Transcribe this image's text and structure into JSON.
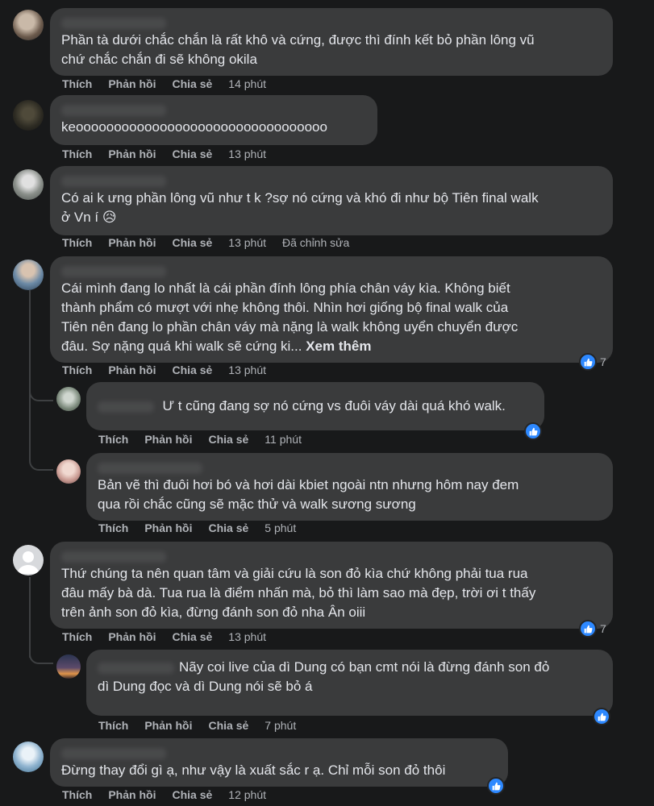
{
  "actions": {
    "like": "Thích",
    "reply": "Phản hồi",
    "share": "Chia sẻ"
  },
  "colors": {
    "background": "#18191a",
    "bubble": "#3a3b3c",
    "like_blue": "#2d88ff",
    "meta_text": "#b0b3b8"
  },
  "comments": [
    {
      "text": "Phần tà dưới chắc chắn là rất khô và cứng, được thì đính kết bỏ phần lông vũ\nchứ chắc chắn đi sẽ không okila",
      "time": "14 phút"
    },
    {
      "text": "keooooooooooooooooooooooooooooooooo",
      "time": "13 phút"
    },
    {
      "text": "Có ai k ưng phần lông vũ như t k ?sợ nó cứng và khó đi như bộ Tiên final walk\nở Vn í 😥",
      "time": "13 phút",
      "edited": "Đã chỉnh sửa"
    },
    {
      "text": "Cái mình đang lo nhất là cái phần đính lông phía chân váy kìa. Không biết\nthành phẩm có mượt với nhẹ không thôi. Nhìn hơi giống bộ final walk của\nTiên nên đang lo phần chân váy mà nặng là walk không uyển chuyển được\nđâu. Sợ nặng quá khi walk sẽ cứng ki...",
      "more": "Xem thêm",
      "time": "13 phút",
      "reactions": "7"
    },
    {
      "text": "Ư t cũng đang sợ nó cứng vs đuôi váy dài quá khó walk.",
      "time": "11 phút"
    },
    {
      "text": "Bản vẽ thì đuôi hơi bó và hơi dài kbiet ngoài ntn nhưng hôm nay đem\nqua rồi chắc cũng sẽ mặc thử và walk sương sương",
      "time": "5 phút"
    },
    {
      "text": "Thứ chúng ta nên quan tâm và giải cứu là son đỏ kìa chứ không phải tua rua\nđâu mấy bà dà. Tua rua là điểm nhấn mà, bỏ thì làm sao mà đẹp, trời ơi t thấy\ntrên ảnh son đỏ kìa, đừng đánh son đỏ nha Ân oiii",
      "time": "13 phút",
      "reactions": "7"
    },
    {
      "text": "Nãy coi live của dì Dung có bạn cmt nói là đừng đánh son đỏ\ndì Dung đọc và dì Dung nói sẽ bỏ á",
      "time": "7 phút"
    },
    {
      "text": "Đừng thay đổi gì ạ, như vậy là xuất sắc r ạ. Chỉ mỗi son đỏ thôi",
      "time": "12 phút"
    }
  ]
}
